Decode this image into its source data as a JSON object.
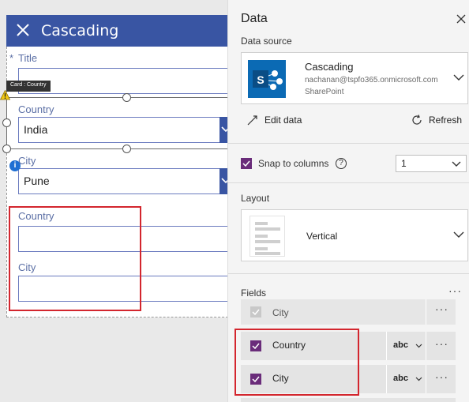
{
  "app": {
    "screen_title": "Cascading"
  },
  "form": {
    "title_label": "Title",
    "title_required_mark": "*",
    "selected_card_tooltip": "Card : Country",
    "country_label": "Country",
    "country_value": "India",
    "city_label": "City",
    "city_value": "Pune",
    "new_country_label": "Country",
    "new_city_label": "City"
  },
  "panel": {
    "title": "Data",
    "data_source_label": "Data source",
    "data_source": {
      "name": "Cascading",
      "account": "nachanan@tspfo365.onmicrosoft.com",
      "type": "SharePoint"
    },
    "edit_data_label": "Edit data",
    "refresh_label": "Refresh",
    "snap_to_columns_label": "Snap to columns",
    "help_glyph": "?",
    "columns_value": "1",
    "layout_label": "Layout",
    "layout_value": "Vertical",
    "fields_label": "Fields",
    "more_glyph": "···",
    "fields": [
      {
        "name": "City",
        "checked": true,
        "dim": true
      },
      {
        "name": "Country",
        "checked": true,
        "type": "abc"
      },
      {
        "name": "City",
        "checked": true,
        "type": "abc"
      }
    ]
  },
  "colors": {
    "header_blue": "#3955a3",
    "checkbox_purple": "#6a2c7a",
    "highlight_red": "#d3262e",
    "sharepoint_blue": "#0b6ab4"
  },
  "icons": [
    "close-icon",
    "chevron-down-icon",
    "warning-icon",
    "info-icon",
    "sharepoint-icon",
    "edit-icon",
    "refresh-icon",
    "help-icon",
    "checkmark-icon",
    "more-icon"
  ]
}
